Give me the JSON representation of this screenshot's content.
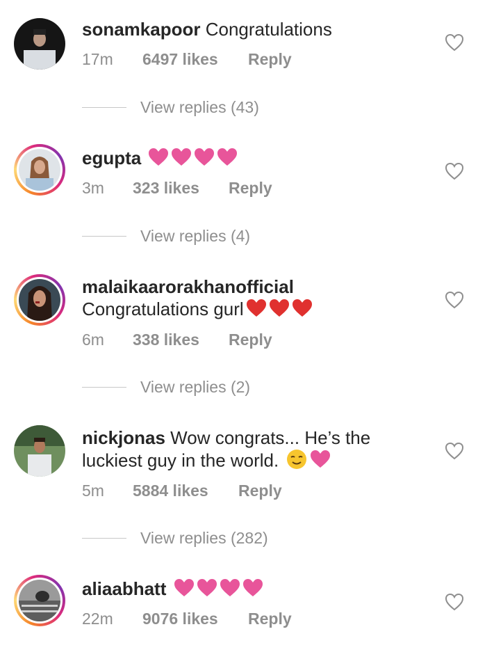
{
  "comments": [
    {
      "username": "sonamkapoor",
      "text": "Congratulations",
      "time": "17m",
      "likes": "6497 likes",
      "reply": "Reply",
      "view_replies": "View replies (43)",
      "story_ring": false
    },
    {
      "username": "egupta",
      "text": "",
      "emoji": "pink-heart-icon x4",
      "time": "3m",
      "likes": "323 likes",
      "reply": "Reply",
      "view_replies": "View replies (4)",
      "story_ring": true
    },
    {
      "username": "malaikaarorakhanofficial",
      "text": "Congratulations gurl",
      "emoji": "red-heart-icon x3",
      "time": "6m",
      "likes": "338 likes",
      "reply": "Reply",
      "view_replies": "View replies (2)",
      "story_ring": true
    },
    {
      "username": "nickjonas",
      "text": "Wow congrats... He’s the luckiest guy in the world.",
      "emoji": "smiling-face-icon, pink-heart-icon",
      "time": "5m",
      "likes": "5884 likes",
      "reply": "Reply",
      "view_replies": "View replies (282)",
      "story_ring": false
    },
    {
      "username": "aliaabhatt",
      "text": "",
      "emoji": "pink-heart-icon x4",
      "time": "22m",
      "likes": "9076 likes",
      "reply": "Reply",
      "story_ring": true
    }
  ],
  "colors": {
    "text": "#262626",
    "muted": "#8e8e8e",
    "pink_heart": "#e8559a",
    "red_heart": "#e0312f"
  }
}
